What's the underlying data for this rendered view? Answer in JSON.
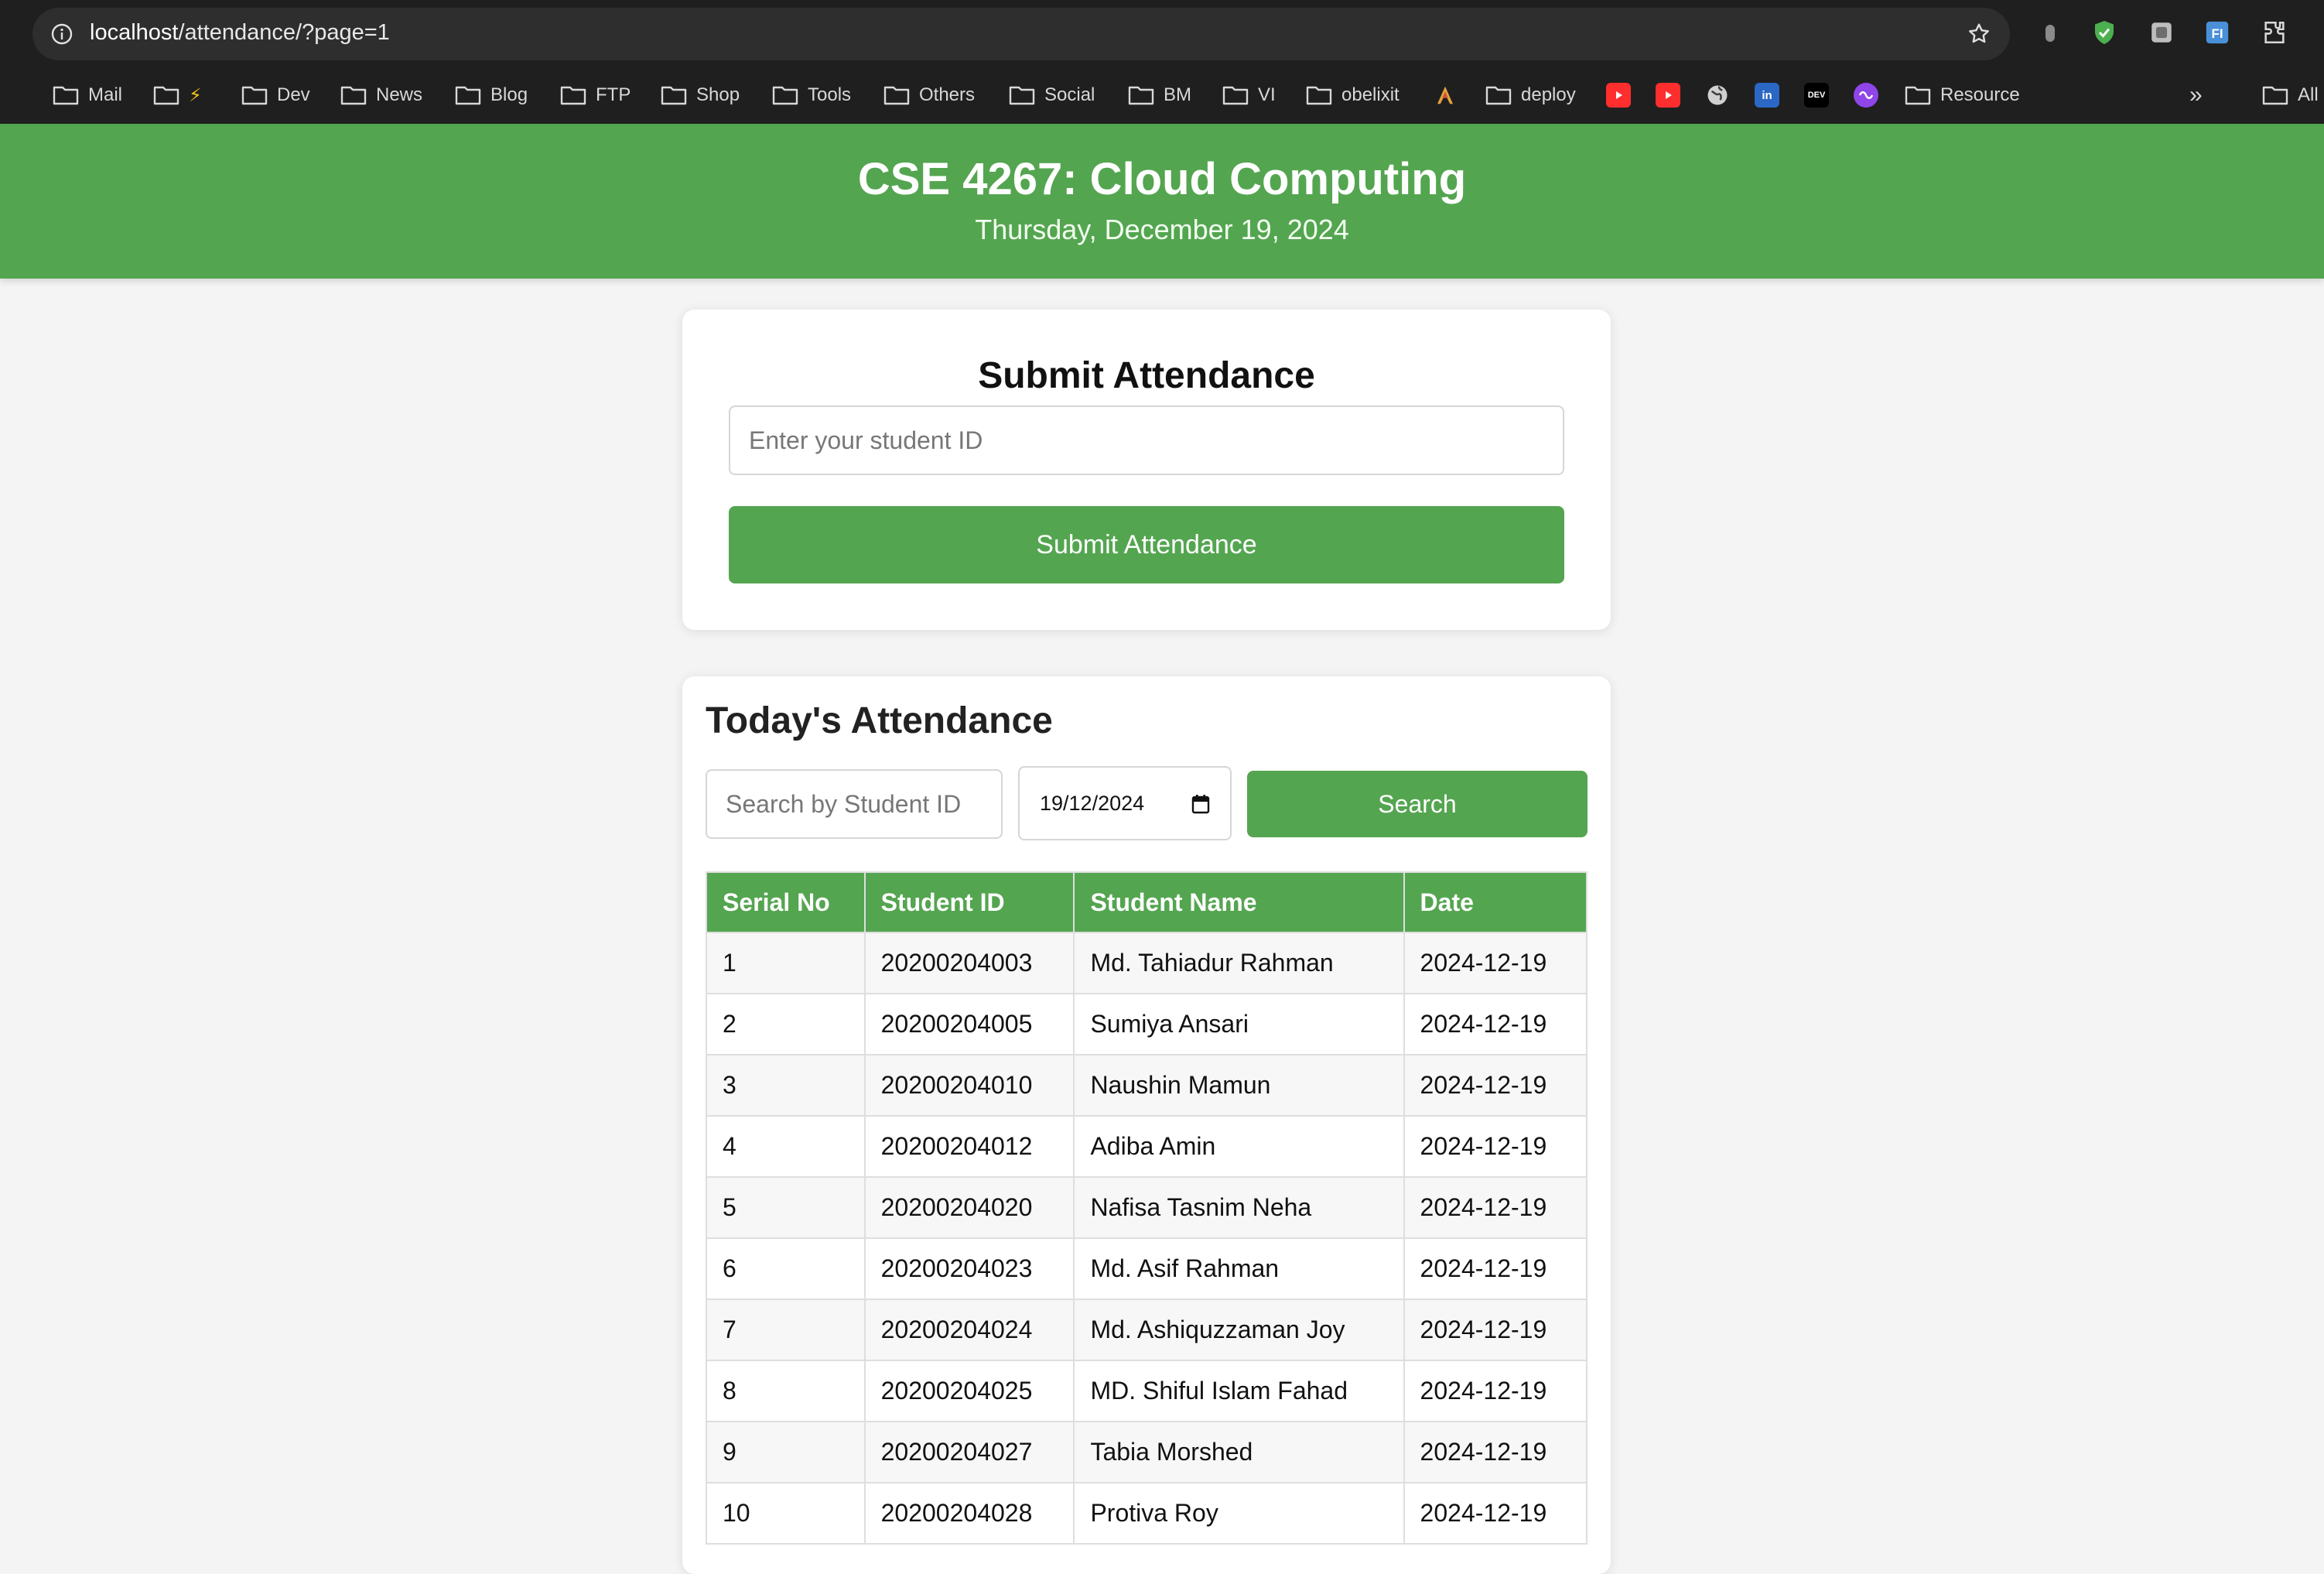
{
  "browser": {
    "url_host": "localhost",
    "url_path": "/attendance/?page=1",
    "bookmarks": [
      {
        "label": "Mail"
      },
      {
        "label": "⚡"
      },
      {
        "label": "Dev"
      },
      {
        "label": "News"
      },
      {
        "label": "Blog"
      },
      {
        "label": "FTP"
      },
      {
        "label": "Shop"
      },
      {
        "label": "Tools"
      },
      {
        "label": "Others"
      },
      {
        "label": "Social"
      },
      {
        "label": "BM"
      },
      {
        "label": "VI"
      },
      {
        "label": "obelixit"
      },
      {
        "label": "deploy"
      },
      {
        "label": "Resource"
      },
      {
        "label": "All"
      }
    ],
    "bookmark_icons": [
      "youtube-icon",
      "youtube-icon",
      "globe-icon",
      "linkedin-icon",
      "dev-icon",
      "purple-app-icon"
    ],
    "linkedin_text": "in",
    "dev_text": "DEV",
    "more_glyph": "»"
  },
  "header": {
    "title": "CSE 4267: Cloud Computing",
    "date": "Thursday, December 19, 2024",
    "color": "#54a550"
  },
  "submit": {
    "heading": "Submit Attendance",
    "input_placeholder": "Enter your student ID",
    "button_label": "Submit Attendance"
  },
  "today": {
    "heading": "Today's Attendance",
    "search_placeholder": "Search by Student ID",
    "date_value": "19/12/2024",
    "search_button": "Search",
    "columns": [
      "Serial No",
      "Student ID",
      "Student Name",
      "Date"
    ],
    "rows": [
      {
        "serial": "1",
        "id": "20200204003",
        "name": "Md. Tahiadur Rahman",
        "date": "2024-12-19"
      },
      {
        "serial": "2",
        "id": "20200204005",
        "name": "Sumiya Ansari",
        "date": "2024-12-19"
      },
      {
        "serial": "3",
        "id": "20200204010",
        "name": "Naushin Mamun",
        "date": "2024-12-19"
      },
      {
        "serial": "4",
        "id": "20200204012",
        "name": "Adiba Amin",
        "date": "2024-12-19"
      },
      {
        "serial": "5",
        "id": "20200204020",
        "name": "Nafisa Tasnim Neha",
        "date": "2024-12-19"
      },
      {
        "serial": "6",
        "id": "20200204023",
        "name": "Md. Asif Rahman",
        "date": "2024-12-19"
      },
      {
        "serial": "7",
        "id": "20200204024",
        "name": "Md. Ashiquzzaman Joy",
        "date": "2024-12-19"
      },
      {
        "serial": "8",
        "id": "20200204025",
        "name": "MD. Shiful Islam Fahad",
        "date": "2024-12-19"
      },
      {
        "serial": "9",
        "id": "20200204027",
        "name": "Tabia Morshed",
        "date": "2024-12-19"
      },
      {
        "serial": "10",
        "id": "20200204028",
        "name": "Protiva Roy",
        "date": "2024-12-19"
      }
    ]
  }
}
